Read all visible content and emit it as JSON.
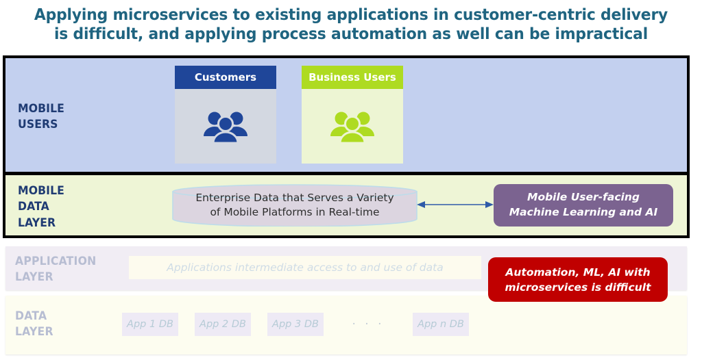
{
  "title": {
    "line1": "Applying microservices to existing applications in customer-centric delivery",
    "line2": "is difficult, and applying process automation as well can be impractical",
    "color": "#1F6480"
  },
  "layers": {
    "mobile_users": {
      "label_line1": "MOBILE",
      "label_line2": "USERS",
      "background": "#C3D0EF",
      "label_color": "#1F3B73",
      "cards": [
        {
          "title": "Customers",
          "icon": "people-group-icon",
          "header_color": "#1F4699",
          "body_color": "#D3D8E1",
          "icon_color": "#1F4699"
        },
        {
          "title": "Business Users",
          "icon": "people-group-icon",
          "header_color": "#AEDB21",
          "body_color": "#EDF5D3",
          "icon_color": "#AEDB21"
        }
      ]
    },
    "mobile_data": {
      "label_line1": "MOBILE",
      "label_line2": "DATA",
      "label_line3": "LAYER",
      "background": "#EEF5D6",
      "label_color": "#1F3B73",
      "cylinder": {
        "icon": "database-cylinder-icon",
        "text_line1": "Enterprise Data that Serves a Variety",
        "text_line2": "of Mobile Platforms in Real-time",
        "fill": "#DCD5E0",
        "stroke": "#BDDCEA"
      },
      "connector": {
        "icon": "double-arrow-icon",
        "color": "#2E5AA8"
      },
      "ml_box": {
        "text_line1": "Mobile User-facing",
        "text_line2": "Machine Learning and AI",
        "fill": "#7B6390",
        "text_color": "#FFFFFF"
      }
    },
    "application": {
      "label_line1": "APPLICATION",
      "label_line2": "LAYER",
      "background": "#F1EDF4",
      "label_color": "#B7BDD2",
      "strip_text": "Applications intermediate access to and use of data",
      "strip_background": "#FDFBEE",
      "strip_text_color": "#CFDCE6"
    },
    "data": {
      "label_line1": "DATA",
      "label_line2": "LAYER",
      "background": "#FDFDF0",
      "label_color": "#B7BDD2",
      "databases": [
        "App 1 DB",
        "App 2 DB",
        "App 3 DB"
      ],
      "ellipsis": "· · ·",
      "last_database": "App n DB",
      "db_background": "#EEEAF5",
      "db_text_color": "#B6CBD6"
    }
  },
  "callout": {
    "text_line1": "Automation, ML, AI with",
    "text_line2": "microservices is difficult",
    "fill": "#C00000",
    "text_color": "#FFFFFF"
  }
}
